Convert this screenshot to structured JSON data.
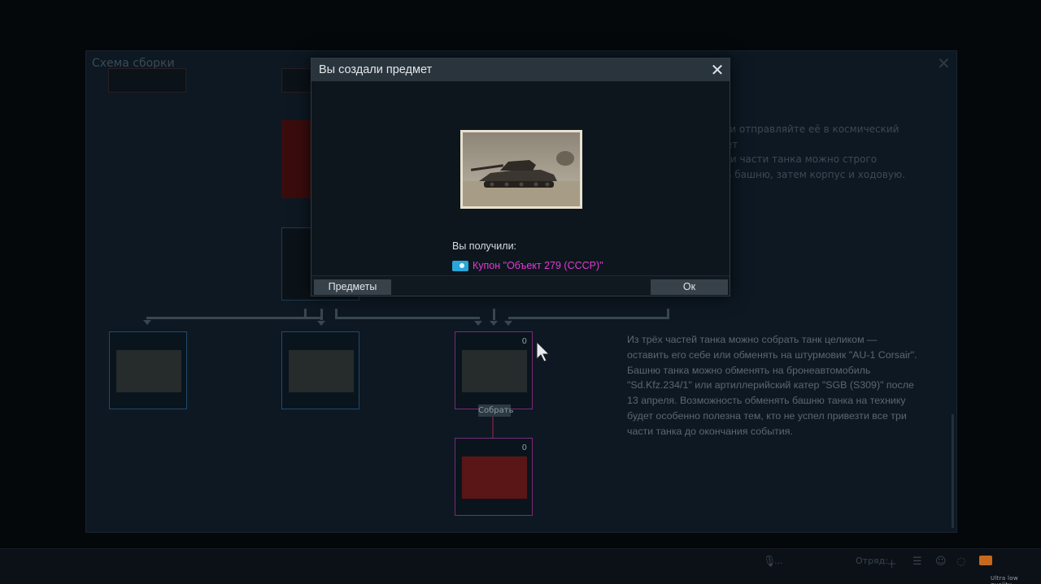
{
  "background": {
    "panel_title": "Схема сборки",
    "description_top": "вом и отправляйте её в космический полет\nвезти части танка можно строго\nчала башню, затем корпус и ходовую.",
    "description": "Из трёх частей танка можно собрать танк целиком — оставить его себе или обменять на штурмовик \"AU-1 Corsair\". Башню танка можно обменять на бронеавтомобиль \"Sd.Kfz.234/1\" или артиллерийский катер \"SGB (S309)\" после 13 апреля. Возможность обменять башню танка на технику будет особенно полезна тем, кто не успел привезти все три части танка до окончания события.",
    "slot_counts": {
      "tank": "0",
      "plane": "0"
    },
    "collect_label": "Собрать",
    "bottom_bar": {
      "squad_label": "Отряд:",
      "mic_label": "..."
    },
    "quality_label": "Ultra low quality"
  },
  "dialog": {
    "title": "Вы создали предмет",
    "received_label": "Вы получили:",
    "reward_text": "Купон \"Объект 279 (СССР)\"",
    "items_button": "Предметы",
    "ok_button": "Ок"
  },
  "colors": {
    "reward": "#e23bd7",
    "coupon_icon": "#2aa6d9",
    "dialog_header": "#2a343d",
    "button": "#37414a"
  }
}
